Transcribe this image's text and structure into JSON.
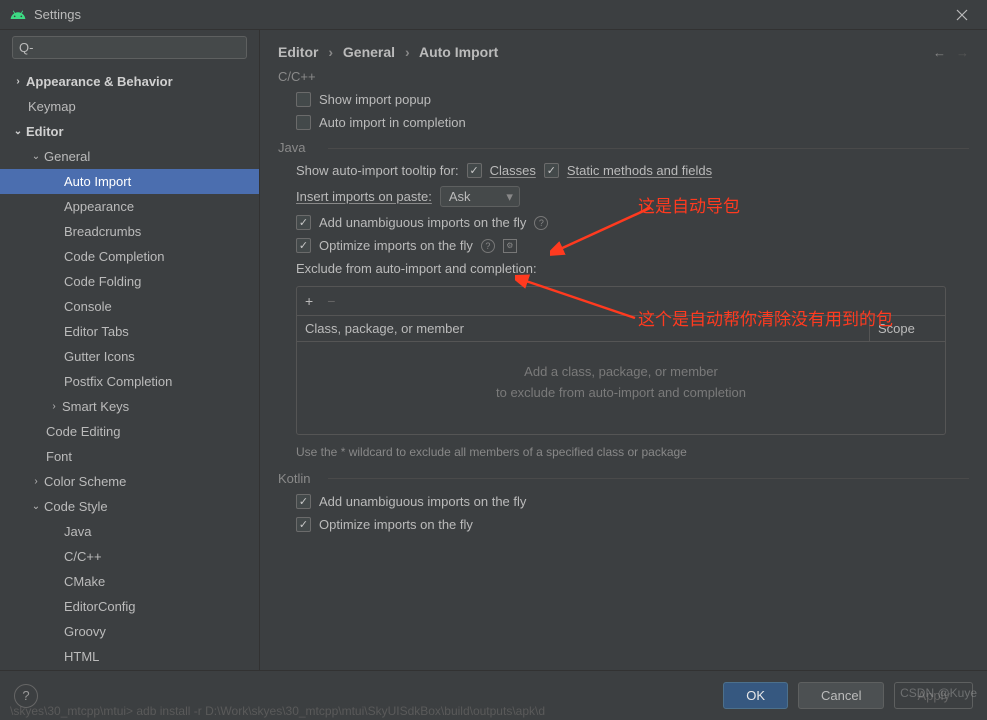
{
  "window": {
    "title": "Settings"
  },
  "search": {
    "placeholder": ""
  },
  "tree": {
    "appearance_behavior": "Appearance & Behavior",
    "keymap": "Keymap",
    "editor": "Editor",
    "general": "General",
    "auto_import": "Auto Import",
    "appearance": "Appearance",
    "breadcrumbs": "Breadcrumbs",
    "code_completion": "Code Completion",
    "code_folding": "Code Folding",
    "console": "Console",
    "editor_tabs": "Editor Tabs",
    "gutter_icons": "Gutter Icons",
    "postfix_completion": "Postfix Completion",
    "smart_keys": "Smart Keys",
    "code_editing": "Code Editing",
    "font": "Font",
    "color_scheme": "Color Scheme",
    "code_style": "Code Style",
    "java_item": "Java",
    "cpp": "C/C++",
    "cmake": "CMake",
    "editorconfig": "EditorConfig",
    "groovy": "Groovy",
    "html": "HTML"
  },
  "breadcrumb": {
    "p0": "Editor",
    "p1": "General",
    "p2": "Auto Import"
  },
  "sections": {
    "ccpp": "C/C++",
    "ccpp_popup": "Show import popup",
    "ccpp_auto": "Auto import in completion",
    "java": "Java",
    "java_tooltip_label": "Show auto-import tooltip for:",
    "java_classes": "Classes",
    "java_static": "Static methods and fields",
    "java_insert_label": "Insert imports on paste:",
    "java_insert_value": "Ask",
    "java_add": "Add unambiguous imports on the fly",
    "java_optimize": "Optimize imports on the fly",
    "java_exclude_label": "Exclude from auto-import and completion:",
    "table_col1": "Class, package, or member",
    "table_col2": "Scope",
    "table_empty_l1": "Add a class, package, or member",
    "table_empty_l2": "to exclude from auto-import and completion",
    "wildcard_hint": "Use the * wildcard to exclude all members of a specified class or package",
    "kotlin": "Kotlin",
    "kotlin_add": "Add unambiguous imports on the fly",
    "kotlin_optimize": "Optimize imports on the fly"
  },
  "buttons": {
    "ok": "OK",
    "cancel": "Cancel",
    "apply": "Apply"
  },
  "annotations": {
    "a1": "这是自动导包",
    "a2": "这个是自动帮你清除没有用到的包"
  },
  "watermark": "CSDN @Kuye",
  "bg_cmd": "\\skyes\\30_mtcpp\\mtui>  adb install -r  D:\\Work\\skyes\\30_mtcpp\\mtui\\SkyUISdkBox\\build\\outputs\\apk\\d"
}
